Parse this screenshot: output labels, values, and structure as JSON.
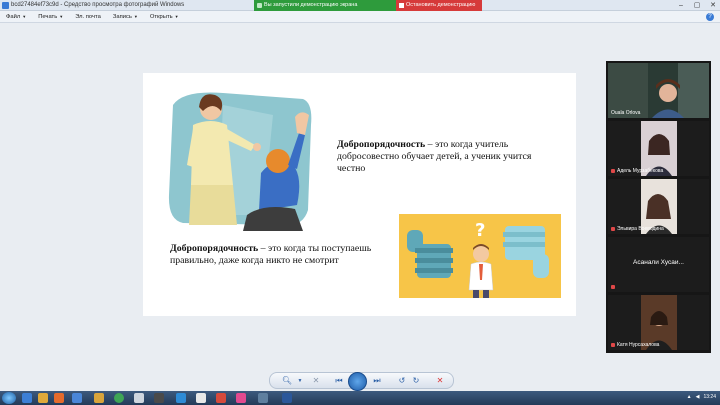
{
  "window": {
    "title": "bcd27484ef73c9d - Средство просмотра фотографий Windows"
  },
  "sharing": {
    "status": "Вы запустили демонстрацию экрана",
    "stop_label": "Остановить демонстрацию"
  },
  "menu": {
    "items": [
      "Файл",
      "Печать",
      "Эл. почта",
      "Запись",
      "Открыть"
    ]
  },
  "slide": {
    "block1": {
      "term": "Добропорядочность",
      "definition": " – это когда учитель добросовестно обучает детей, а ученик учится честно"
    },
    "block2": {
      "term": "Добропорядочность",
      "definition": " – это когда ты поступаешь правильно, даже когда никто не смотрит"
    }
  },
  "participants": [
    {
      "name": "Ouala Orlova",
      "muted": false
    },
    {
      "name": "Адель Мурзабекова",
      "muted": true
    },
    {
      "name": "Эльвира Воеводина",
      "muted": true
    },
    {
      "name": "Асанали Хусаи...",
      "muted": true,
      "no_video": true
    },
    {
      "name": "Катя Нурсахалова",
      "muted": true
    }
  ],
  "clock": {
    "time": "13:24"
  },
  "colors": {
    "share_green": "#2e9b3c",
    "stop_red": "#d63a3a",
    "panel_bg": "#161616",
    "taskbar": "#2b4566"
  }
}
